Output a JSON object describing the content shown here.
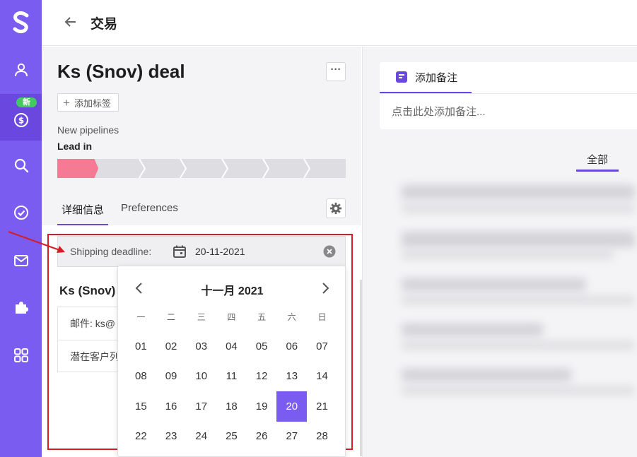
{
  "header": {
    "title": "交易"
  },
  "sidebar": {
    "badge": "新",
    "items": [
      {
        "icon": "person-icon"
      },
      {
        "icon": "dollar-icon"
      },
      {
        "icon": "search-icon"
      },
      {
        "icon": "check-circle-icon"
      },
      {
        "icon": "mail-icon"
      },
      {
        "icon": "puzzle-icon"
      },
      {
        "icon": "apps-grid-icon"
      }
    ]
  },
  "deal": {
    "title": "Ks (Snov) deal",
    "more": "···",
    "add_tag_label": "添加标签",
    "pipeline": "New pipelines",
    "stage": "Lead in"
  },
  "tabs": {
    "details": "详细信息",
    "preferences": "Preferences"
  },
  "field": {
    "label": "Shipping deadline:",
    "value": "20-11-2021"
  },
  "contact": {
    "name": "Ks (Snov)",
    "email_row": "邮件:  ks@",
    "lead_row": "潜在客户列"
  },
  "calendar": {
    "month": "十一月 2021",
    "weekdays": [
      "一",
      "二",
      "三",
      "四",
      "五",
      "六",
      "日"
    ],
    "days": [
      "01",
      "02",
      "03",
      "04",
      "05",
      "06",
      "07",
      "08",
      "09",
      "10",
      "11",
      "12",
      "13",
      "14",
      "15",
      "16",
      "17",
      "18",
      "19",
      "20",
      "21",
      "22",
      "23",
      "24",
      "25",
      "26",
      "27",
      "28"
    ],
    "selected": "20"
  },
  "notes": {
    "tab_label": "添加备注",
    "placeholder": "点击此处添加备注...",
    "filter_all": "全部"
  },
  "colors": {
    "brand": "#7b5cf0",
    "stage_done": "#f47b93",
    "highlight": "#d31e25",
    "badge": "#43c95d"
  }
}
